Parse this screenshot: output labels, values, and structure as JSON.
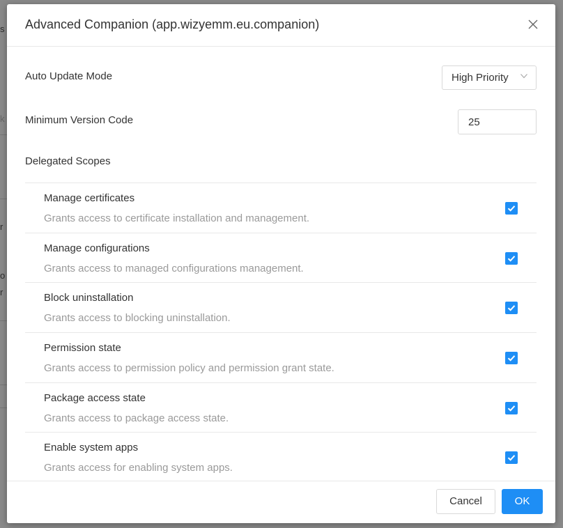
{
  "background": {
    "fragments": [
      "s",
      "k",
      "r",
      "o",
      "r"
    ]
  },
  "dialog": {
    "title": "Advanced Companion (app.wizyemm.eu.companion)",
    "close_label": "X",
    "auto_update": {
      "label": "Auto Update Mode",
      "value": "High Priority"
    },
    "min_version": {
      "label": "Minimum Version Code",
      "value": "25"
    },
    "delegated_scopes": {
      "label": "Delegated Scopes",
      "items": [
        {
          "name": "Manage certificates",
          "description": "Grants access to certificate installation and management.",
          "checked": true
        },
        {
          "name": "Manage configurations",
          "description": "Grants access to managed configurations management.",
          "checked": true
        },
        {
          "name": "Block uninstallation",
          "description": "Grants access to blocking uninstallation.",
          "checked": true
        },
        {
          "name": "Permission state",
          "description": "Grants access to permission policy and permission grant state.",
          "checked": true
        },
        {
          "name": "Package access state",
          "description": "Grants access to package access state.",
          "checked": true
        },
        {
          "name": "Enable system apps",
          "description": "Grants access for enabling system apps.",
          "checked": true
        }
      ]
    },
    "footer": {
      "cancel_label": "Cancel",
      "ok_label": "OK"
    }
  },
  "colors": {
    "accent": "#1e8ef5",
    "overlay": "#7d7d7d"
  }
}
